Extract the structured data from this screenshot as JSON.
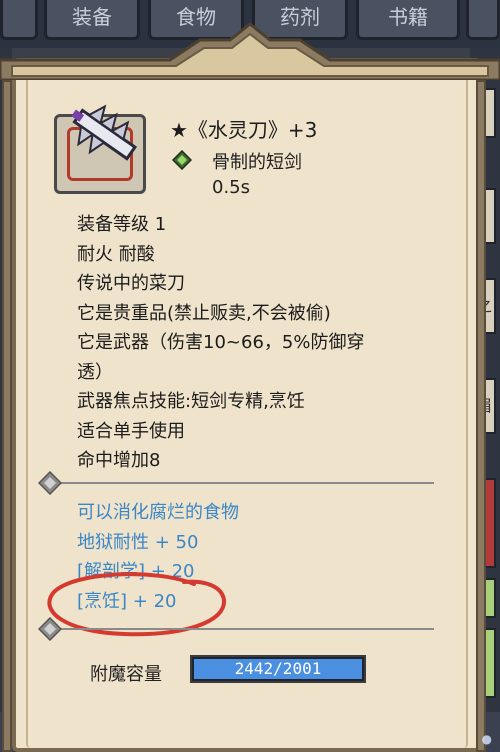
{
  "top_tabs": [
    "装备",
    "食物",
    "药剂",
    "书籍"
  ],
  "item": {
    "title": "★《水灵刀》+3",
    "type": "骨制的短剑",
    "speed": "0.5s"
  },
  "description": [
    "装备等级 1",
    "耐火 耐酸",
    "传说中的菜刀",
    "它是贵重品(禁止贩卖,不会被偷)",
    "它是武器（伤害10~66，5%防御穿",
    "透）",
    "武器焦点技能:短剑专精,烹饪",
    "适合单手使用",
    "命中增加8"
  ],
  "effects": [
    "可以消化腐烂的食物",
    "地狱耐性 + 50",
    "[解剖学] + 20",
    "[烹饪] + 20"
  ],
  "enchant": {
    "label": "附魔容量",
    "value_text": "2442/2001",
    "fill_fraction": 1.0
  },
  "side_text": [
    "书",
    "之",
    "眉"
  ],
  "colors": {
    "parchment": "#efe4cb",
    "effect_text": "#3b86c7",
    "annotation_red": "#d43a2f",
    "capacity_bar": "#4a8fe0"
  }
}
